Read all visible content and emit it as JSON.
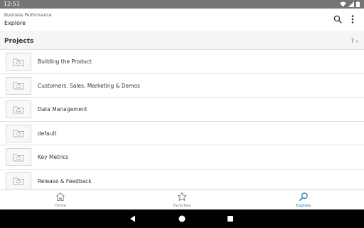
{
  "status_bar": {
    "time": "12:51"
  },
  "header": {
    "subtitle": "Business Performance",
    "title": "Explore"
  },
  "section": {
    "title": "Projects",
    "count": "7 ›"
  },
  "projects": [
    {
      "label": "Building the Product"
    },
    {
      "label": "Customers, Sales, Marketing & Demos"
    },
    {
      "label": "Data Management"
    },
    {
      "label": "default"
    },
    {
      "label": "Key Metrics"
    },
    {
      "label": "Release & Feedback"
    }
  ],
  "bottom_nav": [
    {
      "label": "Home",
      "icon": "home-icon"
    },
    {
      "label": "Favorites",
      "icon": "star-icon"
    },
    {
      "label": "Explore",
      "icon": "explore-icon",
      "active": true
    }
  ],
  "icons": {
    "search": "search-icon",
    "more": "more-vert-icon",
    "thumbnail": "folder-cloud-icon",
    "system_back": "back-triangle-icon",
    "system_home": "home-circle-icon",
    "system_recents": "recents-square-icon"
  },
  "colors": {
    "accent": "#1f77b4",
    "status_bar": "#757575",
    "section_bg": "#f5f5f5",
    "system_nav": "#000000"
  }
}
